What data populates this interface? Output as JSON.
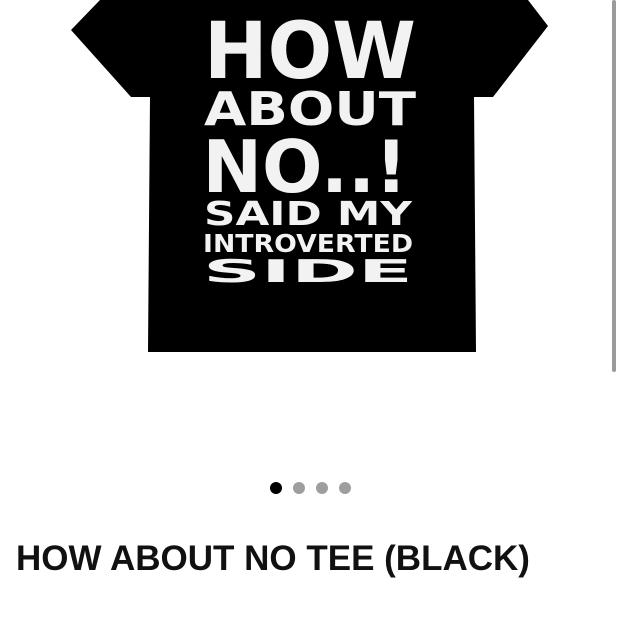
{
  "product": {
    "title": "HOW ABOUT NO TEE (BLACK)",
    "sku": "",
    "image": {
      "print_lines": [
        "HOW",
        "ABOUT",
        "NO..!",
        "SAID MY",
        "INTROVERTED",
        "SIDE"
      ],
      "shirt_color": "#000000",
      "print_color": "#f2f2f2"
    }
  },
  "carousel": {
    "total": 4,
    "active_index": 0
  },
  "colors": {
    "dot_active": "#000000",
    "dot_inactive": "#9e9e9e",
    "title": "#111111"
  }
}
